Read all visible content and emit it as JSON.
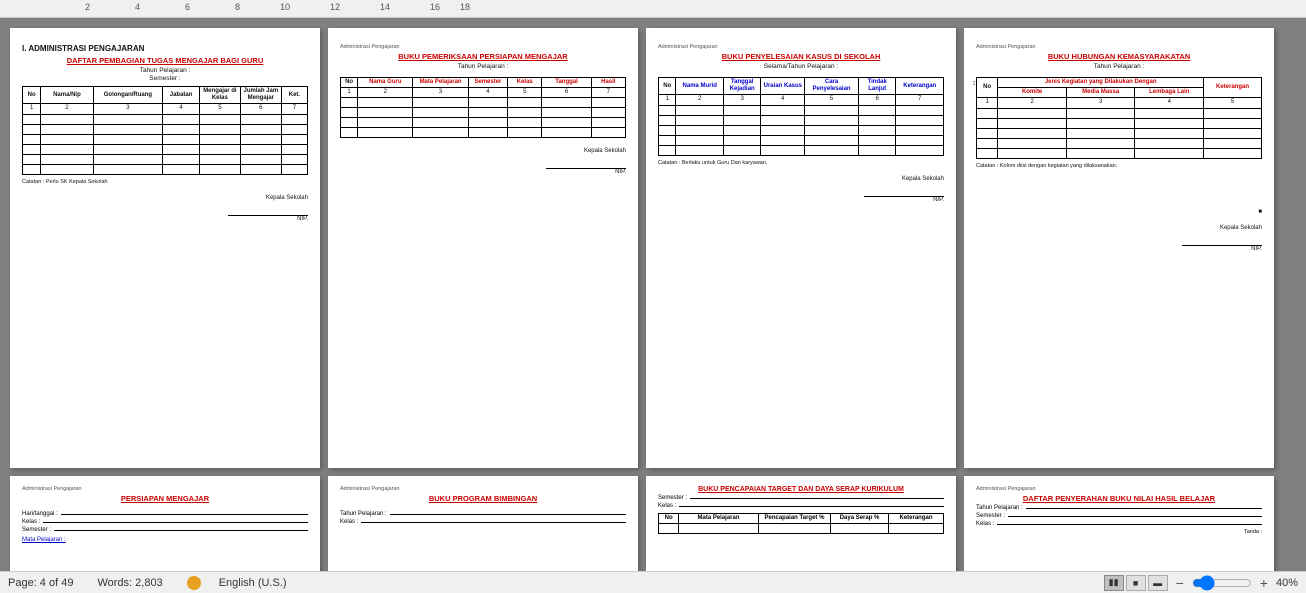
{
  "ruler": {
    "ticks": [
      "2",
      "4",
      "6",
      "8",
      "10",
      "12",
      "14",
      "16",
      "18"
    ]
  },
  "status": {
    "page_info": "Page: 4 of 49",
    "words_info": "Words: 2,803",
    "language": "English (U.S.)",
    "zoom": "40%"
  },
  "pages": [
    {
      "id": "page1",
      "admin_label": "I.  ADMINISTRASI PENGAJARAN",
      "title": "DAFTAR PEMBAGIAN TUGAS MENGAJAR BAGI GURU",
      "subtitle": "Tahun Pelajaran :",
      "sub2": "Semester :",
      "table_headers": [
        "No",
        "Nama/Nip",
        "Golongan/Ruang",
        "Jabatan",
        "Mengajar di Kelas",
        "Jumlah Jam Mengajar",
        "Ket."
      ],
      "note": "Catatan : Perlu SK Kepala Sekolah",
      "sign_title": "Kepala Sekolah",
      "nip": "NIP."
    },
    {
      "id": "page2",
      "admin_label": "Administrasi Pengajaran",
      "title": "BUKU PEMERIKSAAN PERSIAPAN MENGAJAR",
      "subtitle": "Tahun Pelajaran :",
      "table_headers": [
        "No",
        "Nama Guru",
        "Mata Pelajaran",
        "Semester",
        "Kelas",
        "Tanggal",
        "Hasil"
      ],
      "sign_title": "Kepala Sekolah",
      "nip": "NIP."
    },
    {
      "id": "page3",
      "admin_label": "Administrasi Pengajaran",
      "title": "BUKU PENYELESAIAN  KASUS DI SEKOLAH",
      "subtitle": "Selama/Tahun Pelajaran :",
      "table_headers": [
        "No",
        "Nama Murid",
        "Tanggal Kejadian",
        "Uraian Kasus",
        "Cara Penyelesaian",
        "Tindak Lanjut",
        "Keterangan"
      ],
      "note": "Catatan :  Berlaku untuk Guru Dan karyawan.",
      "sign_title": "Kepala Sekolah",
      "nip": "NIP."
    },
    {
      "id": "page4",
      "admin_label": "Administrasi Pengajaran",
      "title": "BUKU HUBUNGAN KEMASYARAKATAN",
      "subtitle": "Tahun Pelajaran :",
      "table_headers_outer": [
        "No",
        "Jenis Kegiatan yang Dilakukan Dengan",
        "Keterangan"
      ],
      "table_headers_inner": [
        "Komite",
        "Media Massa",
        "Lembaga Lain"
      ],
      "note": "Catatan :   Kolom diisi dengan kegiatan yang dilaksanakan.",
      "sign_title": "Kepala Sekolah",
      "nip": "NIP."
    }
  ],
  "bottom_pages": [
    {
      "id": "bp1",
      "admin_label": "Administrasi Pengajaran",
      "title": "PERSIAPAN MENGAJAR",
      "fields": [
        "Hari/tanggal :",
        "Kelas :",
        "Semester :"
      ]
    },
    {
      "id": "bp2",
      "admin_label": "Administrasi Pengajaran",
      "title": "BUKU PROGRAM BIMBINGAN",
      "fields": [
        "Tahun Pelajaran :",
        "Kelas :"
      ]
    },
    {
      "id": "bp3",
      "admin_label": "",
      "title": "BUKU PENCAPAIAN TARGET DAN DAYA SERAP KURIKULUM",
      "fields": [
        "Semester :",
        "Kelas :"
      ],
      "table_headers": [
        "No",
        "Mata Pelajaran",
        "Pencapaian Target %",
        "Daya Serap %",
        "Keterangan"
      ]
    },
    {
      "id": "bp4",
      "admin_label": "Administrasi Pengajaran",
      "title": "DAFTAR PENYERAHAN BUKU NILAI HASIL BELAJAR",
      "fields": [
        "Tahun Pelajaran :",
        "Semester :",
        "Kelas :"
      ]
    }
  ]
}
